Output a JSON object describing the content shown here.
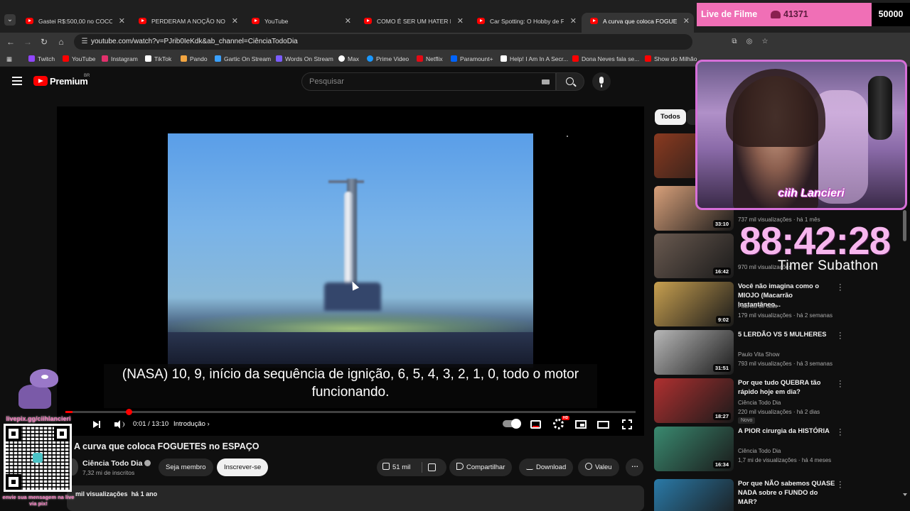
{
  "browser": {
    "tabs": [
      {
        "label": "Gastei R$:500,00 no COCO BAMBU"
      },
      {
        "label": "PERDERAM A NOÇÃO NO CHÁ DE"
      },
      {
        "label": "YouTube"
      },
      {
        "label": "COMO É SER UM HATER DE SU"
      },
      {
        "label": "Car Spotting: O Hobby de Foto"
      },
      {
        "label": "A curva que coloca FOGUETES"
      }
    ],
    "url": "youtube.com/watch?v=PJrib0IeKdk&ab_channel=CiênciaTodoDia",
    "bookmarks": [
      {
        "label": "Twitch",
        "color": "#9146ff"
      },
      {
        "label": "YouTube",
        "color": "#ff0000"
      },
      {
        "label": "Instagram",
        "color": "#e1306c"
      },
      {
        "label": "TikTok",
        "color": "#ffffff"
      },
      {
        "label": "Pando",
        "color": "#f2a541"
      },
      {
        "label": "Gartic On Stream",
        "color": "#3aa0ff"
      },
      {
        "label": "Words On Stream",
        "color": "#7b5cff"
      },
      {
        "label": "Max",
        "color": "#ffffff"
      },
      {
        "label": "Prime Video",
        "color": "#1a98ff"
      },
      {
        "label": "Netflix",
        "color": "#e50914"
      },
      {
        "label": "Paramount+",
        "color": "#0064ff"
      },
      {
        "label": "Help! I Am In A Secr...",
        "color": "#ffffff"
      },
      {
        "label": "Dona Neves fala se...",
        "color": "#ff0000"
      },
      {
        "label": "Show do Milhão",
        "color": "#ff0000"
      }
    ]
  },
  "youtube": {
    "brand": "Premium",
    "region": "BR",
    "search_placeholder": "Pesquisar"
  },
  "player": {
    "caption_line1": "(NASA) 10, 9, início da sequência de ignição, 6, 5, 4, 3, 2, 1, 0, todo o motor",
    "caption_line2": "funcionando.",
    "time": "0:01 / 13:10",
    "chapter": "Introdução",
    "progress": 0.0013
  },
  "video": {
    "title": "A curva que coloca FOGUETES no ESPAÇO",
    "channel": "Ciência Todo Dia",
    "subscribers": "7,32 mi de inscritos",
    "join_label": "Seja membro",
    "subscribe_label": "Inscrever-se",
    "likes": "51 mil",
    "share_label": "Compartilhar",
    "download_label": "Download",
    "thanks_label": "Valeu",
    "views": "mil visualizações",
    "age": "há 1 ano"
  },
  "sidebar": {
    "chip_all": "Todos",
    "items": [
      {
        "title": "",
        "channel": "",
        "meta": "",
        "duration": "",
        "thumb": "#8a3a20"
      },
      {
        "title": "",
        "channel": "",
        "meta": "737 mil visualizações · há 1 mês",
        "duration": "33:10",
        "thumb": "#d8a07a"
      },
      {
        "title": "",
        "channel": "",
        "meta": "970 mil visualizações",
        "duration": "16:42",
        "thumb": "#6a5a50"
      },
      {
        "title": "Você não imagina como o MIOJO (Macarrão Instantâneo...",
        "channel": "Fábrica de tudo",
        "meta": "179 mil visualizações · há 2 semanas",
        "duration": "9:02",
        "thumb": "#c8a050"
      },
      {
        "title": "5 LERDÃO VS 5 MULHERES",
        "channel": "Paulo Vita Show",
        "meta": "793 mil visualizações · há 3 semanas",
        "duration": "31:51",
        "thumb": "#b8b8b8"
      },
      {
        "title": "Por que tudo QUEBRA tão rápido hoje em dia?",
        "channel": "Ciência Todo Dia",
        "meta": "220 mil visualizações · há 2 dias",
        "duration": "18:27",
        "badge": "Novo",
        "thumb": "#b03030"
      },
      {
        "title": "A PIOR cirurgia da HISTÓRIA",
        "channel": "Ciência Todo Dia",
        "meta": "1,7 mi de visualizações · há 4 meses",
        "duration": "16:34",
        "thumb": "#3a8a70"
      },
      {
        "title": "Por que NÃO sabemos QUASE NADA sobre o FUNDO do MAR?",
        "channel": "",
        "meta": "",
        "duration": "",
        "thumb": "#2a7aa8"
      }
    ]
  },
  "overlay": {
    "live_title": "Live de Filme",
    "live_count": "41371",
    "goal": "50000",
    "streamer_name": "ciih Lancieri",
    "timer": "88:42:28",
    "timer_label": "Timer Subathon",
    "pix_url": "livepix.gg/ciihlancieri",
    "pix_message": "envie sua mensagem na live via pix!"
  }
}
